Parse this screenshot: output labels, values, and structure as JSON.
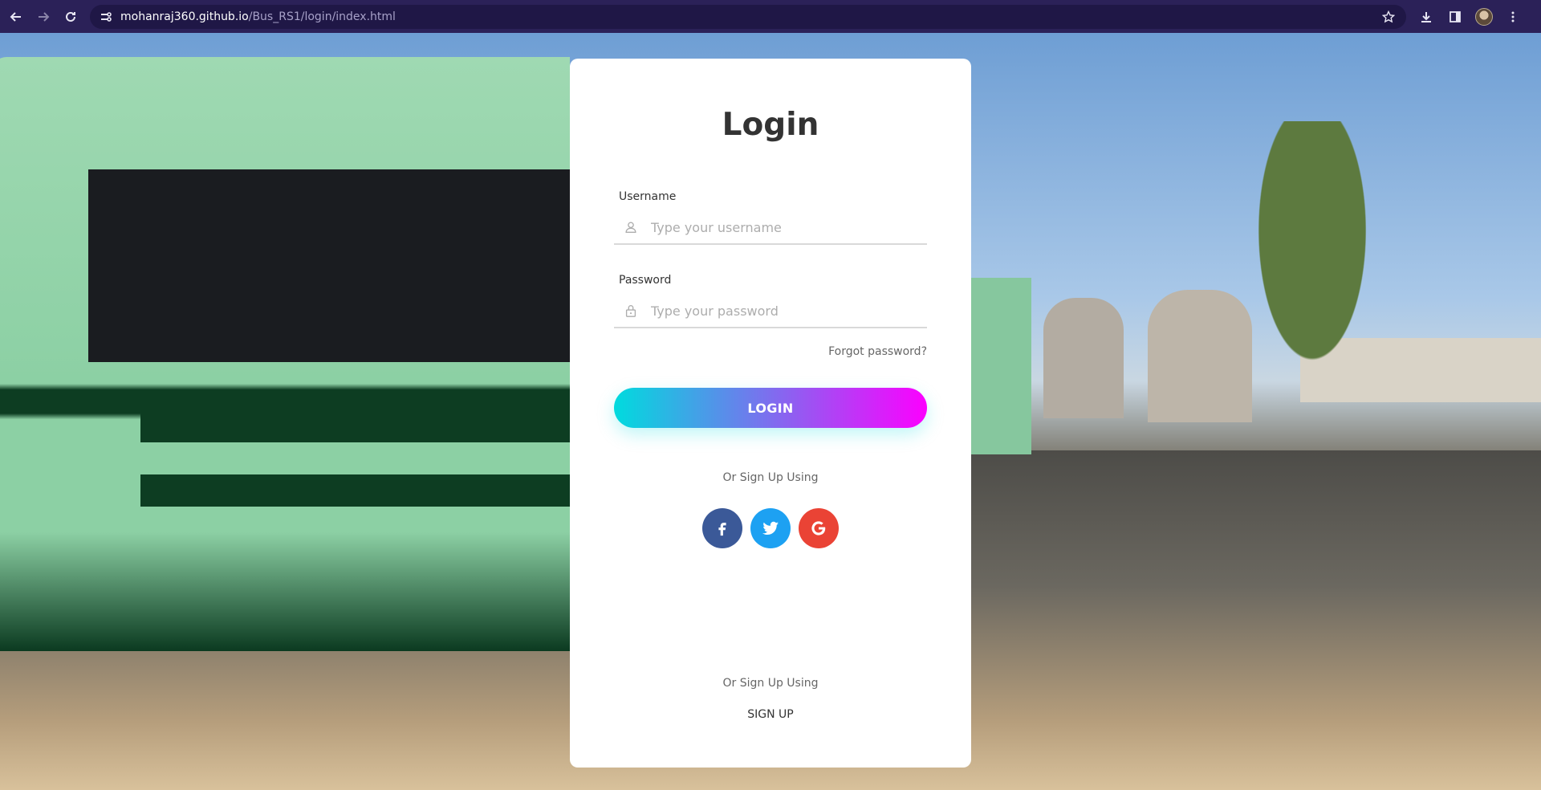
{
  "browser": {
    "url_host": "mohanraj360.github.io",
    "url_path": "/Bus_RS1/login/index.html"
  },
  "login": {
    "title": "Login",
    "username_label": "Username",
    "username_placeholder": "Type your username",
    "password_label": "Password",
    "password_placeholder": "Type your password",
    "forgot_password": "Forgot password?",
    "login_button": "LOGIN",
    "social_prompt": "Or Sign Up Using",
    "socials": [
      {
        "name": "facebook",
        "glyph": "f",
        "color": "#3b5998"
      },
      {
        "name": "twitter",
        "glyph": "t",
        "color": "#1da1f2"
      },
      {
        "name": "google",
        "glyph": "G",
        "color": "#ea4335"
      }
    ],
    "signup_prompt": "Or Sign Up Using",
    "signup_link": "SIGN UP"
  },
  "colors": {
    "gradient_start": "#00dbde",
    "gradient_end": "#fc00ff",
    "browser_bar": "#2b2158"
  }
}
